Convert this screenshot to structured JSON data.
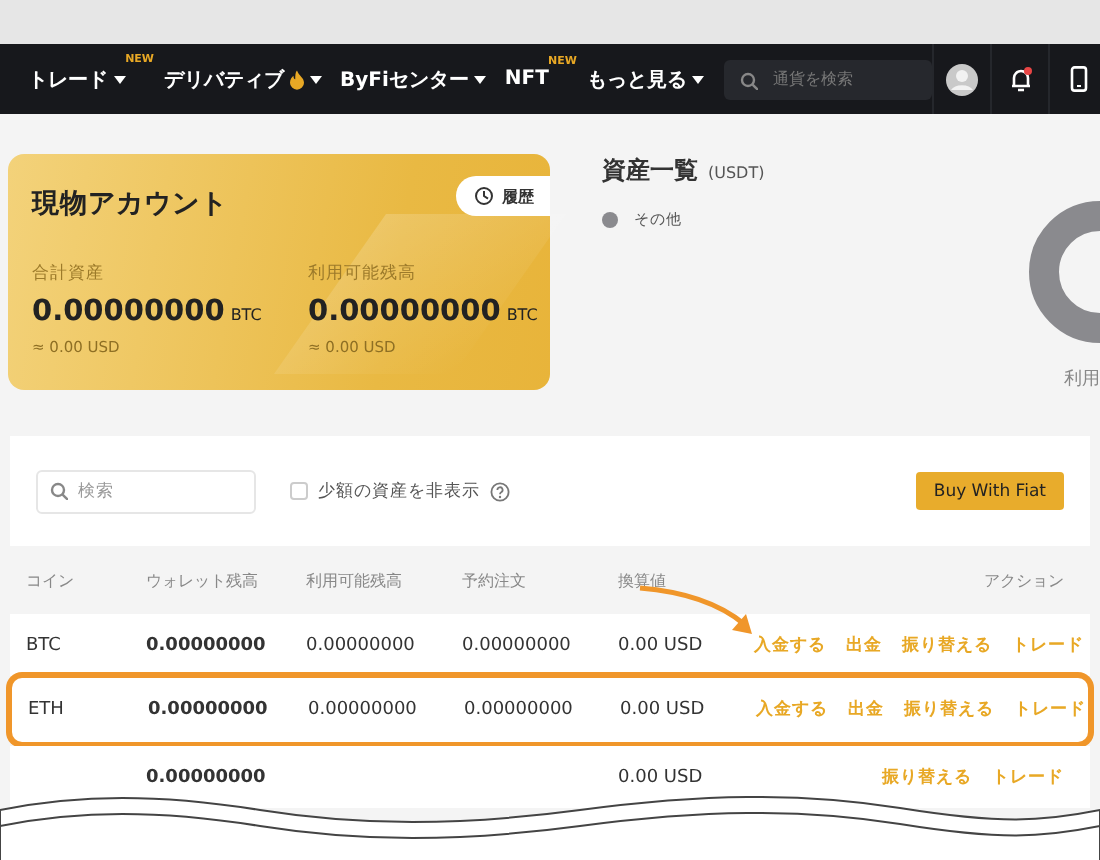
{
  "nav": {
    "items": [
      {
        "label": "トレード",
        "badge": "NEW",
        "caret": true,
        "hot": false
      },
      {
        "label": "デリバティブ",
        "caret": true,
        "hot": true
      },
      {
        "label": "ByFiセンター",
        "caret": true,
        "hot": false
      },
      {
        "label": "NFT",
        "badge": "NEW",
        "caret": false,
        "hot": false
      },
      {
        "label": "もっと見る",
        "caret": true,
        "hot": false
      }
    ],
    "search": {
      "placeholder": "通貨を検索"
    },
    "notification_dot": true
  },
  "account_card": {
    "title": "現物アカウント",
    "history_button": "履歴",
    "stats": [
      {
        "label": "合計資産",
        "value": "0.00000000",
        "unit": "BTC",
        "converted": "≈ 0.00 USD"
      },
      {
        "label": "利用可能残高",
        "value": "0.00000000",
        "unit": "BTC",
        "converted": "≈ 0.00 USD"
      }
    ]
  },
  "overview": {
    "title": "資産一覧",
    "unit": "(USDT)",
    "legend": [
      {
        "label": "その他",
        "color": "#8a8a8e"
      }
    ],
    "donut_label": "利用"
  },
  "filters": {
    "search": {
      "placeholder": "検索"
    },
    "hide_small": {
      "label": "少額の資産を非表示",
      "checked": false
    },
    "buy_button": "Buy With Fiat"
  },
  "table": {
    "columns": [
      "コイン",
      "ウォレット残高",
      "利用可能残高",
      "予約注文",
      "換算値",
      "アクション"
    ],
    "rows": [
      {
        "coin": "BTC",
        "wallet": "0.00000000",
        "available": "0.00000000",
        "reserved": "0.00000000",
        "value": "0.00 USD",
        "actions": [
          "入金する",
          "出金",
          "振り替える",
          "トレード"
        ],
        "highlighted": false
      },
      {
        "coin": "ETH",
        "wallet": "0.00000000",
        "available": "0.00000000",
        "reserved": "0.00000000",
        "value": "0.00 USD",
        "actions": [
          "入金する",
          "出金",
          "振り替える",
          "トレード"
        ],
        "highlighted": true
      },
      {
        "wallet": "0.00000000",
        "value": "0.00 USD",
        "actions": [
          "振り替える",
          "トレード"
        ],
        "highlighted": false
      }
    ]
  }
}
